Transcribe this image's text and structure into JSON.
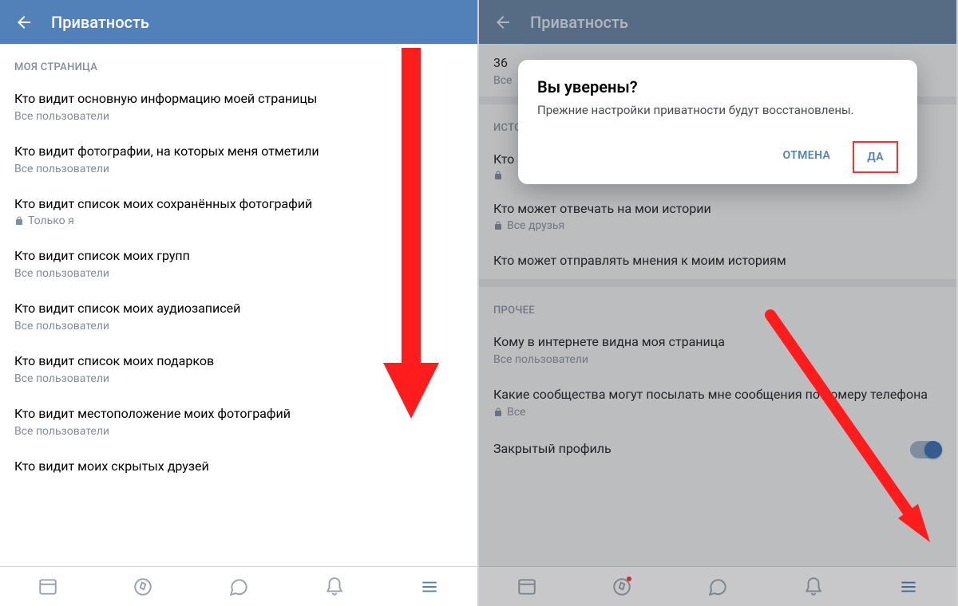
{
  "header_title": "Приватность",
  "all_users": "Все пользователи",
  "all_friends": "Все друзья",
  "only_me": "Только я",
  "all": "Все",
  "left": {
    "section": "МОЯ СТРАНИЦА",
    "items": [
      {
        "title": "Кто видит основную информацию моей страницы",
        "sub": "Все пользователи",
        "lock": false
      },
      {
        "title": "Кто видит фотографии, на которых меня отметили",
        "sub": "Все пользователи",
        "lock": false
      },
      {
        "title": "Кто видит список моих сохранённых фотографий",
        "sub": "Только я",
        "lock": true
      },
      {
        "title": "Кто видит список моих групп",
        "sub": "Все пользователи",
        "lock": false
      },
      {
        "title": "Кто видит список моих аудиозаписей",
        "sub": "Все пользователи",
        "lock": false
      },
      {
        "title": "Кто видит список моих подарков",
        "sub": "Все пользователи",
        "lock": false
      },
      {
        "title": "Кто видит местоположение моих фотографий",
        "sub": "Все пользователи",
        "lock": false
      },
      {
        "title": "Кто видит моих скрытых друзей",
        "sub": "",
        "lock": false
      }
    ]
  },
  "right": {
    "top_number": "36",
    "top_sub": "Все",
    "section1": "ИСТО",
    "section2": "ПРОЧЕЕ",
    "items_a": [
      {
        "title": "Кто",
        "sub": "",
        "lock": true
      },
      {
        "title": "Кто может отвечать на мои истории",
        "sub": "Все друзья",
        "lock": true
      },
      {
        "title": "Кто может отправлять мнения к моим историям",
        "sub": "",
        "lock": false
      }
    ],
    "items_b": [
      {
        "title": "Кому в интернете видна моя страница",
        "sub": "Все пользователи",
        "lock": false
      },
      {
        "title": "Какие сообщества могут посылать мне сообщения по номеру телефона",
        "sub": "Все",
        "lock": true
      }
    ],
    "toggle_label": "Закрытый профиль"
  },
  "dialog": {
    "title": "Вы уверены?",
    "message": "Прежние настройки приватности будут восстановлены.",
    "cancel": "ОТМЕНА",
    "ok": "ДА"
  },
  "colors": {
    "accent": "#5181B8",
    "arrow": "#FF1C1C"
  }
}
